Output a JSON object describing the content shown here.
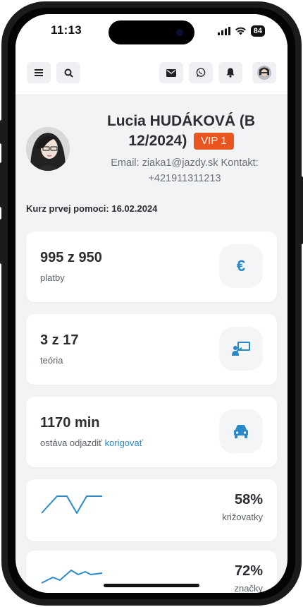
{
  "status_bar": {
    "time": "11:13",
    "battery": "84"
  },
  "header": {
    "buttons": [
      "menu-icon",
      "search-icon",
      "mail-icon",
      "whatsapp-icon",
      "bell-icon"
    ]
  },
  "profile": {
    "name_line": "Lucia HUDÁKOVÁ (B 12/2024)",
    "badge": "VIP 1",
    "contact_line": "Email: ziaka1@jazdy.sk Kontakt: +421911311213",
    "course": "Kurz prvej pomoci: 16.02.2024"
  },
  "cards": {
    "payments": {
      "value": "995 z 950",
      "label": "platby",
      "icon": "euro-icon"
    },
    "theory": {
      "value": "3 z 17",
      "label": "teória",
      "icon": "presentation-icon"
    },
    "driving": {
      "value": "1170 min",
      "label": "ostáva odjazdiť",
      "link": "korigovať",
      "icon": "car-icon"
    },
    "crossroads": {
      "percent": "58%",
      "label": "križovatky"
    },
    "signs": {
      "percent": "72%",
      "label": "značky"
    }
  },
  "colors": {
    "accent": "#2a8ac8",
    "badge": "#e8551f",
    "background": "#f2f3f5"
  }
}
